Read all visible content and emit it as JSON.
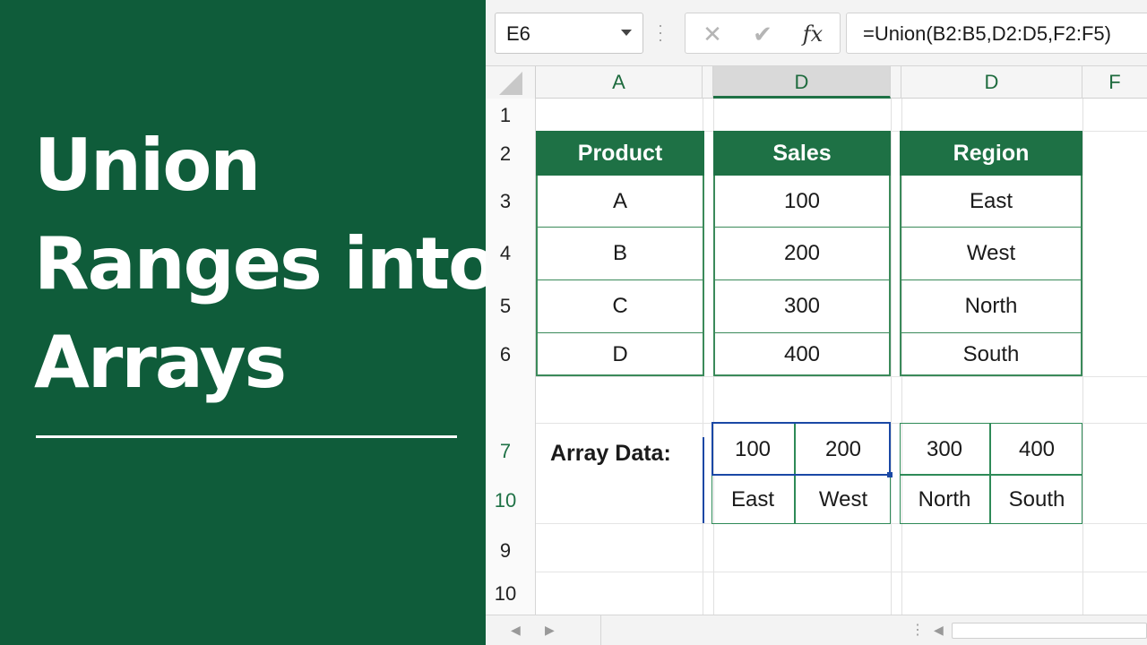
{
  "title": {
    "lines": [
      "Union",
      "Ranges into",
      "Arrays"
    ]
  },
  "formula_bar": {
    "name_box": "E6",
    "cancel_icon": "close-icon",
    "enter_icon": "checkmark-icon",
    "fx_label": "fx",
    "formula": "=Union(B2:B5,D2:D5,F2:F5)"
  },
  "columns": [
    "A",
    "D",
    "D",
    "F"
  ],
  "rows": [
    "1",
    "2",
    "3",
    "4",
    "5",
    "6",
    "7",
    "10",
    "9",
    "10"
  ],
  "tables": {
    "product": {
      "header": "Product",
      "values": [
        "A",
        "B",
        "C",
        "D"
      ]
    },
    "sales": {
      "header": "Sales",
      "values": [
        "100",
        "200",
        "300",
        "400"
      ]
    },
    "region": {
      "header": "Region",
      "values": [
        "East",
        "West",
        "North",
        "South"
      ]
    }
  },
  "array": {
    "label": "Array Data:",
    "row1": [
      "100",
      "200",
      "300",
      "400"
    ],
    "row2": [
      "East",
      "West",
      "North",
      "South"
    ]
  },
  "colors": {
    "panel_green": "#0f5c3a",
    "header_green": "#1e7145",
    "selection_blue": "#1a48a5"
  }
}
